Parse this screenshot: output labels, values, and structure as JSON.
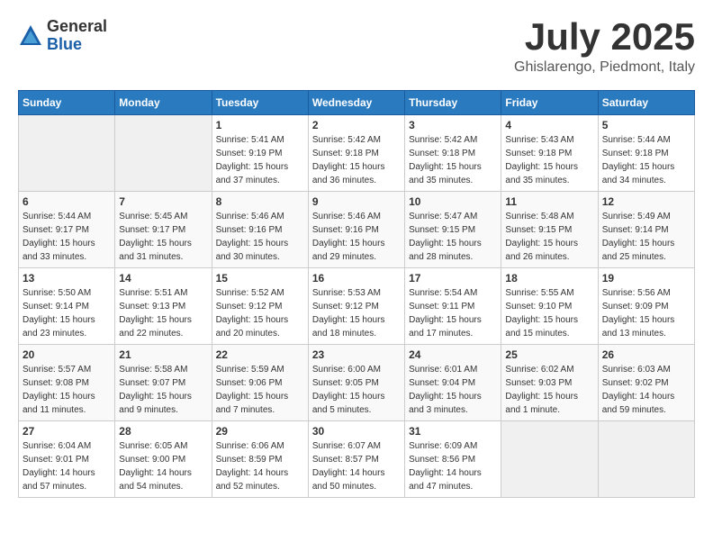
{
  "logo": {
    "general": "General",
    "blue": "Blue"
  },
  "title": "July 2025",
  "location": "Ghislarengo, Piedmont, Italy",
  "weekdays": [
    "Sunday",
    "Monday",
    "Tuesday",
    "Wednesday",
    "Thursday",
    "Friday",
    "Saturday"
  ],
  "weeks": [
    [
      {
        "day": "",
        "info": ""
      },
      {
        "day": "",
        "info": ""
      },
      {
        "day": "1",
        "info": "Sunrise: 5:41 AM\nSunset: 9:19 PM\nDaylight: 15 hours\nand 37 minutes."
      },
      {
        "day": "2",
        "info": "Sunrise: 5:42 AM\nSunset: 9:18 PM\nDaylight: 15 hours\nand 36 minutes."
      },
      {
        "day": "3",
        "info": "Sunrise: 5:42 AM\nSunset: 9:18 PM\nDaylight: 15 hours\nand 35 minutes."
      },
      {
        "day": "4",
        "info": "Sunrise: 5:43 AM\nSunset: 9:18 PM\nDaylight: 15 hours\nand 35 minutes."
      },
      {
        "day": "5",
        "info": "Sunrise: 5:44 AM\nSunset: 9:18 PM\nDaylight: 15 hours\nand 34 minutes."
      }
    ],
    [
      {
        "day": "6",
        "info": "Sunrise: 5:44 AM\nSunset: 9:17 PM\nDaylight: 15 hours\nand 33 minutes."
      },
      {
        "day": "7",
        "info": "Sunrise: 5:45 AM\nSunset: 9:17 PM\nDaylight: 15 hours\nand 31 minutes."
      },
      {
        "day": "8",
        "info": "Sunrise: 5:46 AM\nSunset: 9:16 PM\nDaylight: 15 hours\nand 30 minutes."
      },
      {
        "day": "9",
        "info": "Sunrise: 5:46 AM\nSunset: 9:16 PM\nDaylight: 15 hours\nand 29 minutes."
      },
      {
        "day": "10",
        "info": "Sunrise: 5:47 AM\nSunset: 9:15 PM\nDaylight: 15 hours\nand 28 minutes."
      },
      {
        "day": "11",
        "info": "Sunrise: 5:48 AM\nSunset: 9:15 PM\nDaylight: 15 hours\nand 26 minutes."
      },
      {
        "day": "12",
        "info": "Sunrise: 5:49 AM\nSunset: 9:14 PM\nDaylight: 15 hours\nand 25 minutes."
      }
    ],
    [
      {
        "day": "13",
        "info": "Sunrise: 5:50 AM\nSunset: 9:14 PM\nDaylight: 15 hours\nand 23 minutes."
      },
      {
        "day": "14",
        "info": "Sunrise: 5:51 AM\nSunset: 9:13 PM\nDaylight: 15 hours\nand 22 minutes."
      },
      {
        "day": "15",
        "info": "Sunrise: 5:52 AM\nSunset: 9:12 PM\nDaylight: 15 hours\nand 20 minutes."
      },
      {
        "day": "16",
        "info": "Sunrise: 5:53 AM\nSunset: 9:12 PM\nDaylight: 15 hours\nand 18 minutes."
      },
      {
        "day": "17",
        "info": "Sunrise: 5:54 AM\nSunset: 9:11 PM\nDaylight: 15 hours\nand 17 minutes."
      },
      {
        "day": "18",
        "info": "Sunrise: 5:55 AM\nSunset: 9:10 PM\nDaylight: 15 hours\nand 15 minutes."
      },
      {
        "day": "19",
        "info": "Sunrise: 5:56 AM\nSunset: 9:09 PM\nDaylight: 15 hours\nand 13 minutes."
      }
    ],
    [
      {
        "day": "20",
        "info": "Sunrise: 5:57 AM\nSunset: 9:08 PM\nDaylight: 15 hours\nand 11 minutes."
      },
      {
        "day": "21",
        "info": "Sunrise: 5:58 AM\nSunset: 9:07 PM\nDaylight: 15 hours\nand 9 minutes."
      },
      {
        "day": "22",
        "info": "Sunrise: 5:59 AM\nSunset: 9:06 PM\nDaylight: 15 hours\nand 7 minutes."
      },
      {
        "day": "23",
        "info": "Sunrise: 6:00 AM\nSunset: 9:05 PM\nDaylight: 15 hours\nand 5 minutes."
      },
      {
        "day": "24",
        "info": "Sunrise: 6:01 AM\nSunset: 9:04 PM\nDaylight: 15 hours\nand 3 minutes."
      },
      {
        "day": "25",
        "info": "Sunrise: 6:02 AM\nSunset: 9:03 PM\nDaylight: 15 hours\nand 1 minute."
      },
      {
        "day": "26",
        "info": "Sunrise: 6:03 AM\nSunset: 9:02 PM\nDaylight: 14 hours\nand 59 minutes."
      }
    ],
    [
      {
        "day": "27",
        "info": "Sunrise: 6:04 AM\nSunset: 9:01 PM\nDaylight: 14 hours\nand 57 minutes."
      },
      {
        "day": "28",
        "info": "Sunrise: 6:05 AM\nSunset: 9:00 PM\nDaylight: 14 hours\nand 54 minutes."
      },
      {
        "day": "29",
        "info": "Sunrise: 6:06 AM\nSunset: 8:59 PM\nDaylight: 14 hours\nand 52 minutes."
      },
      {
        "day": "30",
        "info": "Sunrise: 6:07 AM\nSunset: 8:57 PM\nDaylight: 14 hours\nand 50 minutes."
      },
      {
        "day": "31",
        "info": "Sunrise: 6:09 AM\nSunset: 8:56 PM\nDaylight: 14 hours\nand 47 minutes."
      },
      {
        "day": "",
        "info": ""
      },
      {
        "day": "",
        "info": ""
      }
    ]
  ]
}
